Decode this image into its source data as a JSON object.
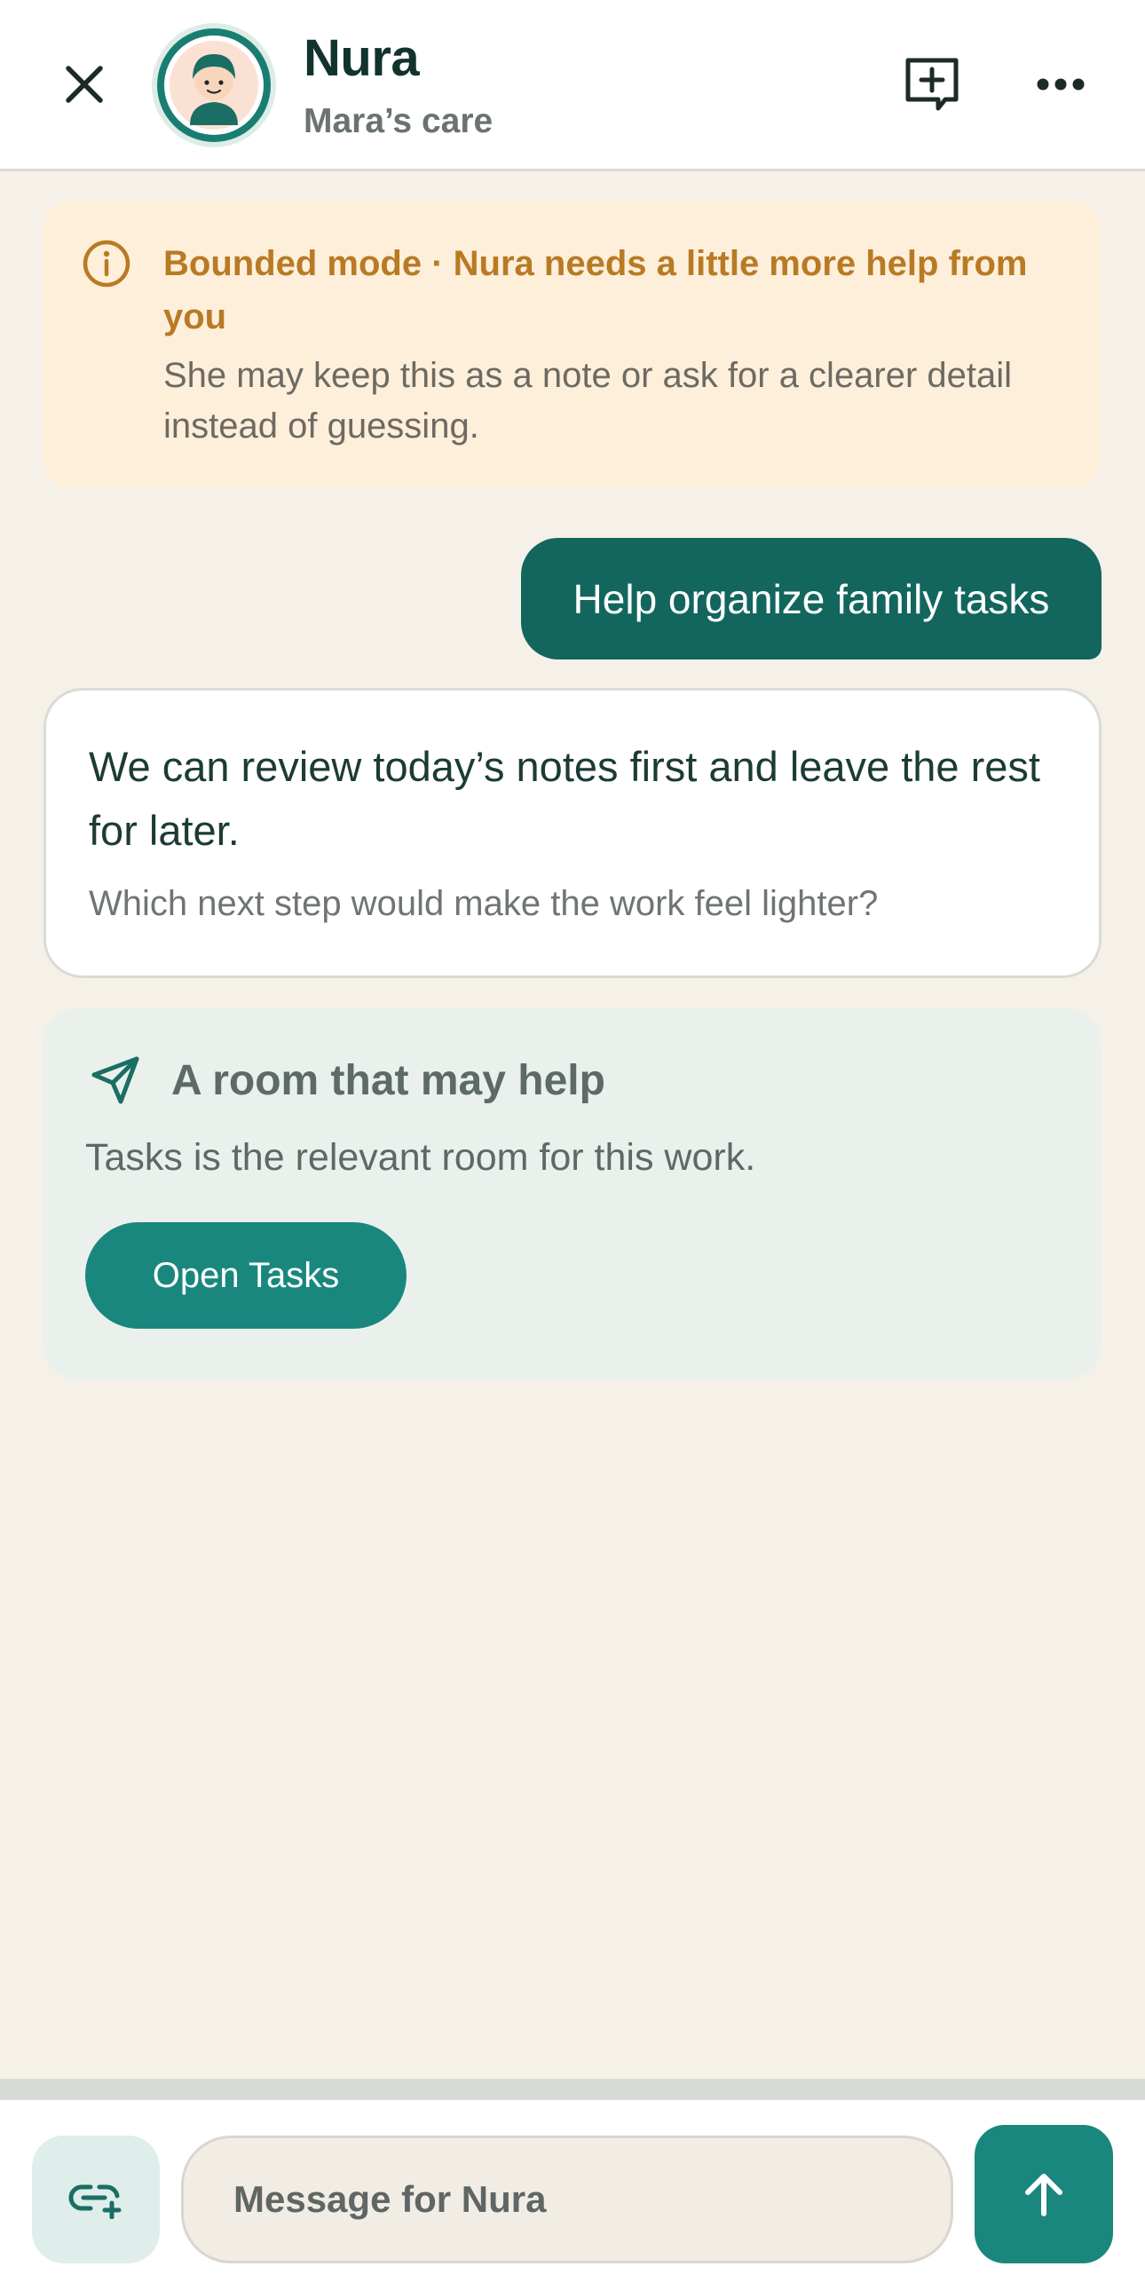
{
  "header": {
    "name": "Nura",
    "subtitle": "Mara’s care",
    "icons": [
      "close-icon",
      "avatar",
      "new-chat-icon",
      "more-icon"
    ]
  },
  "banner": {
    "title": "Bounded mode · Nura needs a little more help from you",
    "body": "She may keep this as a note or ask for a clearer detail instead of guessing.",
    "icon": "info-icon",
    "color": "#b97a24"
  },
  "user_message": "Help organize family tasks",
  "assistant": {
    "message": "We can review today’s notes first and leave the rest for later.",
    "question": "Which next step would make the work feel lighter?"
  },
  "room": {
    "icon": "navigation-arrow-icon",
    "title": "A room that may help",
    "description": "Tasks is the relevant room for this work.",
    "button_label": "Open Tasks"
  },
  "composer": {
    "placeholder": "Message for Nura",
    "attach_icon": "link-add-icon",
    "send_icon": "arrow-up-icon"
  },
  "colors": {
    "accent": "#1a877e",
    "accent_dark": "#12665e",
    "background": "#f5f0e8",
    "banner_bg": "#fdefda",
    "room_bg": "#eaf1ec"
  }
}
